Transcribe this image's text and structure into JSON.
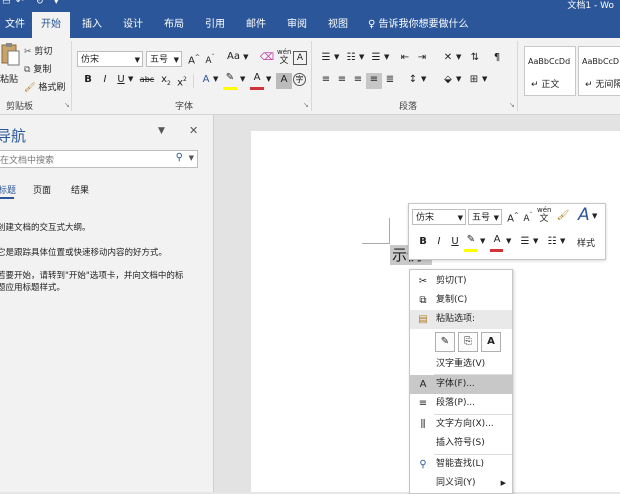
{
  "window": {
    "title": "文档1 - Wo"
  },
  "tabs": [
    {
      "label": "文件"
    },
    {
      "label": "开始"
    },
    {
      "label": "插入"
    },
    {
      "label": "设计"
    },
    {
      "label": "布局"
    },
    {
      "label": "引用"
    },
    {
      "label": "邮件"
    },
    {
      "label": "审阅"
    },
    {
      "label": "视图"
    }
  ],
  "tell_me": {
    "text": "告诉我你想要做什么"
  },
  "clipboard": {
    "paste_label": "粘贴",
    "cut_label": "剪切",
    "copy_label": "复制",
    "format_painter_label": "格式刷",
    "group_label": "剪贴板"
  },
  "font": {
    "name": "仿宋",
    "size": "五号",
    "group_label": "字体",
    "change_case": "Aa",
    "wen": "wén",
    "wen_char": "文"
  },
  "paragraph": {
    "group_label": "段落"
  },
  "styles": {
    "items": [
      {
        "sample": "AaBbCcDd",
        "name": "↵ 正文"
      },
      {
        "sample": "AaBbCcD",
        "name": "↵ 无间隔"
      }
    ]
  },
  "nav": {
    "title": "导航",
    "search_placeholder": "在文档中搜索",
    "tabs": [
      {
        "label": "标题"
      },
      {
        "label": "页面"
      },
      {
        "label": "结果"
      }
    ],
    "lines": [
      "创建文档的交互式大纲。",
      "它是跟踪具体位置或快速移动内容的好方式。",
      "若要开始，请转到\"开始\"选项卡，并向文档中的标",
      "题应用标题样式。"
    ]
  },
  "document": {
    "selected_text": "示例"
  },
  "mini_toolbar": {
    "font_name": "仿宋",
    "font_size": "五号",
    "styles_label": "样式",
    "wen": "wén",
    "wen_char": "文"
  },
  "context_menu": {
    "items": [
      {
        "label": "剪切(T)",
        "icon": "scissors-icon"
      },
      {
        "label": "复制(C)",
        "icon": "copy-icon"
      },
      {
        "label": "粘贴选项:",
        "icon": "paste-icon"
      },
      {
        "label": "汉字重选(V)",
        "icon": ""
      },
      {
        "label": "字体(F)...",
        "icon": "font-icon"
      },
      {
        "label": "段落(P)...",
        "icon": "paragraph-icon"
      },
      {
        "label": "文字方向(X)...",
        "icon": "text-direction-icon"
      },
      {
        "label": "插入符号(S)",
        "icon": ""
      },
      {
        "label": "智能查找(L)",
        "icon": "smart-lookup-icon"
      },
      {
        "label": "同义词(Y)",
        "icon": ""
      }
    ]
  },
  "colors": {
    "accent": "#2b579a",
    "font_color": "#d13438",
    "highlight": "#ffff00"
  }
}
